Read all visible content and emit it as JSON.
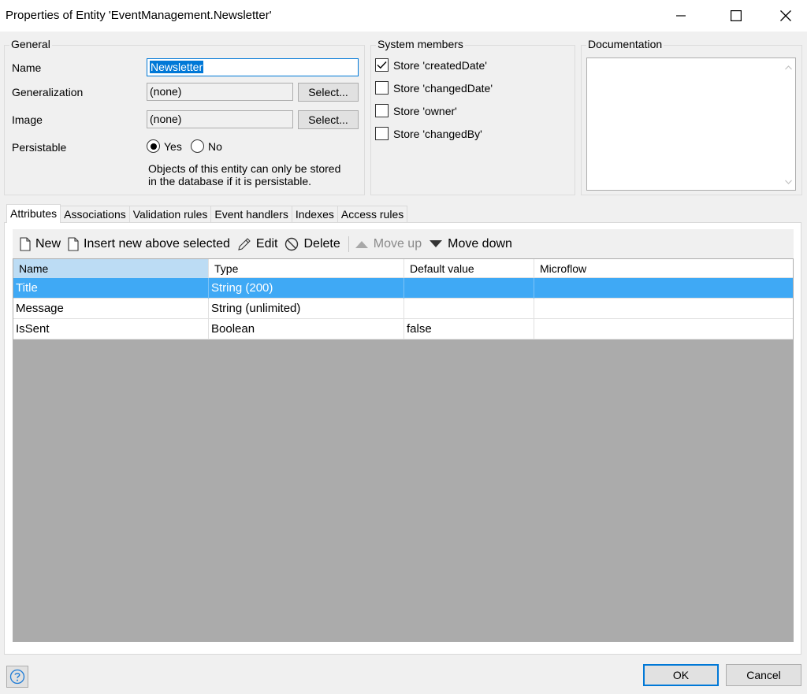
{
  "window": {
    "title": "Properties of Entity 'EventManagement.Newsletter'"
  },
  "general": {
    "label": "General",
    "name_label": "Name",
    "name_value": "Newsletter",
    "generalization_label": "Generalization",
    "generalization_value": "(none)",
    "image_label": "Image",
    "image_value": "(none)",
    "select_label": "Select...",
    "persistable_label": "Persistable",
    "yes_label": "Yes",
    "no_label": "No",
    "persistable_selected": "Yes",
    "note_line1": "Objects of this entity can only be stored",
    "note_line2": "in the database if it is persistable."
  },
  "system_members": {
    "label": "System members",
    "items": [
      {
        "label": "Store 'createdDate'",
        "checked": true
      },
      {
        "label": "Store 'changedDate'",
        "checked": false
      },
      {
        "label": "Store 'owner'",
        "checked": false
      },
      {
        "label": "Store 'changedBy'",
        "checked": false
      }
    ]
  },
  "documentation": {
    "label": "Documentation",
    "value": ""
  },
  "tabs": [
    "Attributes",
    "Associations",
    "Validation rules",
    "Event handlers",
    "Indexes",
    "Access rules"
  ],
  "active_tab": "Attributes",
  "toolbar": {
    "new": "New",
    "insert": "Insert new above selected",
    "edit": "Edit",
    "delete": "Delete",
    "move_up": "Move up",
    "move_down": "Move down"
  },
  "grid": {
    "columns": [
      "Name",
      "Type",
      "Default value",
      "Microflow"
    ],
    "rows": [
      [
        "Title",
        "String (200)",
        "",
        ""
      ],
      [
        "Message",
        "String (unlimited)",
        "",
        ""
      ],
      [
        "IsSent",
        "Boolean",
        "false",
        ""
      ]
    ],
    "selected_row": 0
  },
  "footer": {
    "ok": "OK",
    "cancel": "Cancel"
  },
  "colors": {
    "accent": "#0078d7",
    "selection": "#3fa9f5",
    "sorted_header": "#bcdcf4"
  }
}
